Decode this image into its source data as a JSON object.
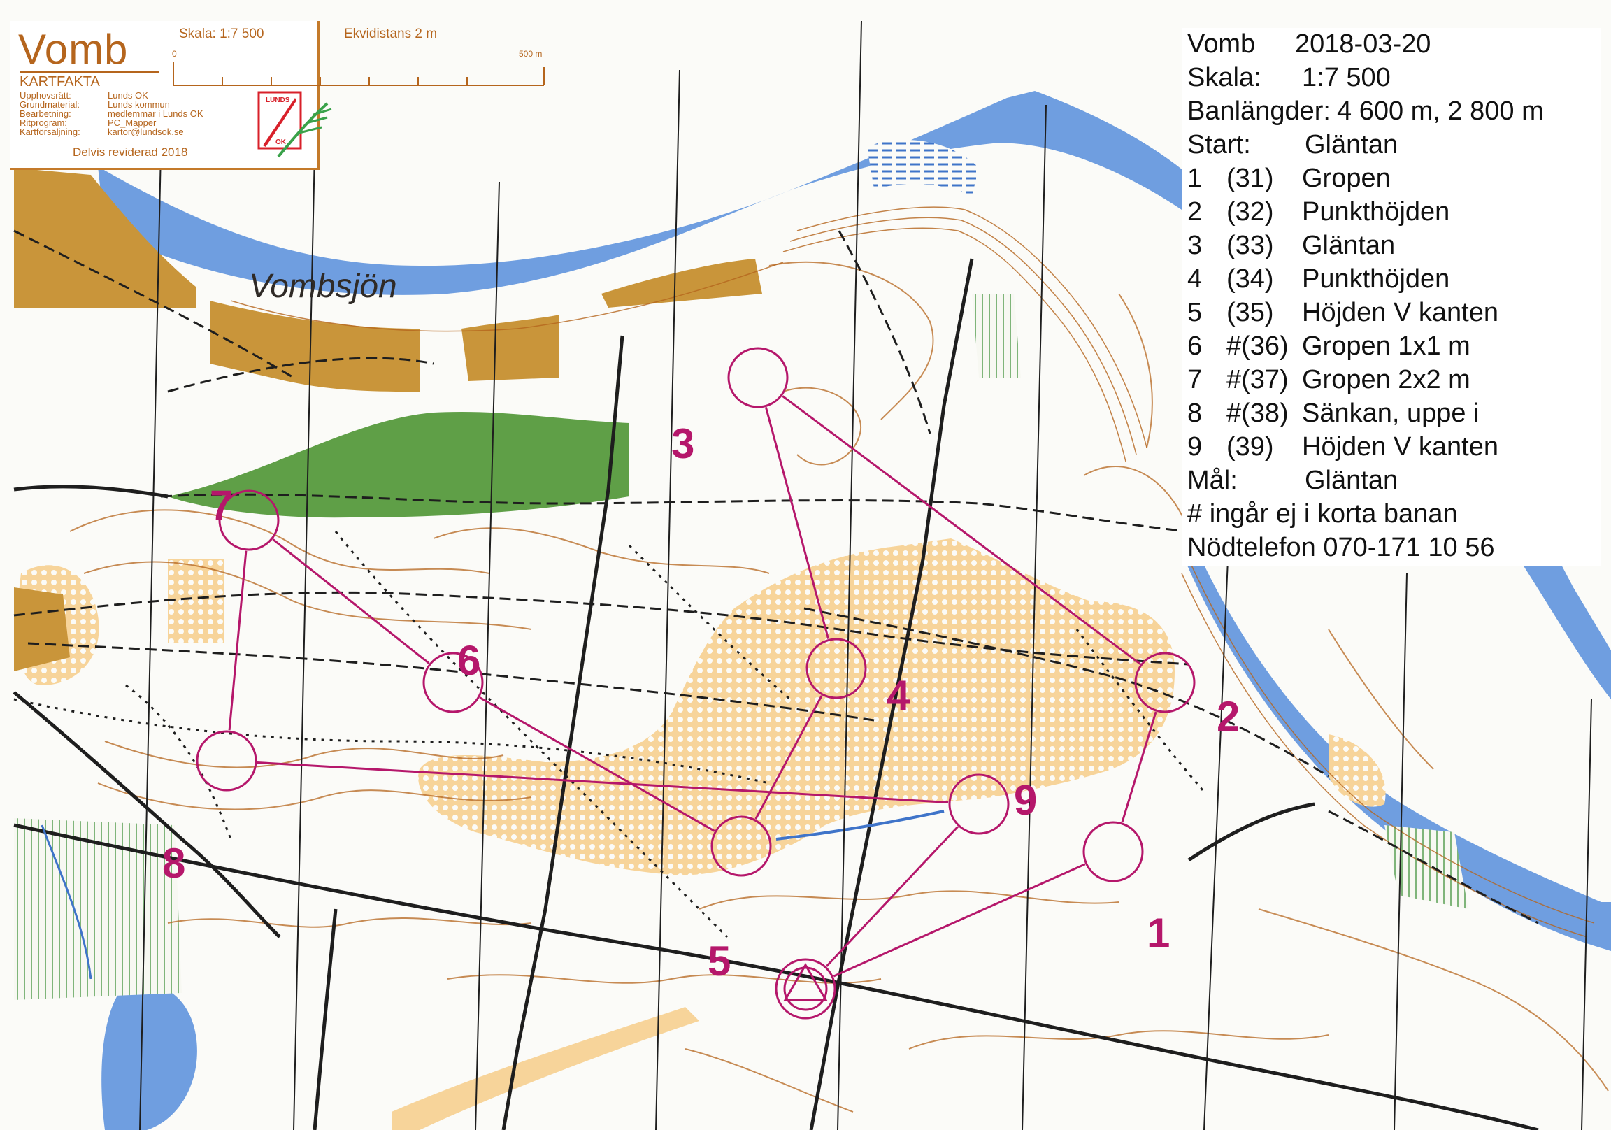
{
  "map_header": {
    "title": "Vomb",
    "kartfakta_heading": "KARTFAKTA",
    "facts": [
      {
        "label": "Upphovsrätt:",
        "value": "Lunds OK"
      },
      {
        "label": "Grundmaterial:",
        "value": "Lunds kommun"
      },
      {
        "label": "Bearbetning:",
        "value": "medlemmar i Lunds OK"
      },
      {
        "label": "Ritprogram:",
        "value": "PC_Mapper"
      },
      {
        "label": "Kartförsäljning:",
        "value": "kartor@lundsok.se"
      }
    ],
    "revision": "Delvis reviderad 2018",
    "scale_label": "Skala: 1:7 500",
    "contour_label": "Ekvidistans 2 m",
    "scale_bar_start": "0",
    "scale_bar_end": "500 m"
  },
  "logo": {
    "top_text": "LUNDS",
    "bottom_text": "OK",
    "colors": {
      "red": "#d8202a",
      "green": "#3aa24a"
    }
  },
  "course_info": {
    "header_name": "Vomb",
    "date": "2018-03-20",
    "scale_label": "Skala:",
    "scale_value": "1:7 500",
    "lengths_label": "Banlängder:",
    "lengths_value": "4 600 m, 2 800 m",
    "start_label": "Start:",
    "start_value": "Gläntan",
    "controls": [
      {
        "num": "1",
        "code": "(31)",
        "desc": "Gropen"
      },
      {
        "num": "2",
        "code": "(32)",
        "desc": "Punkthöjden"
      },
      {
        "num": "3",
        "code": "(33)",
        "desc": "Gläntan"
      },
      {
        "num": "4",
        "code": "(34)",
        "desc": "Punkthöjden"
      },
      {
        "num": "5",
        "code": "(35)",
        "desc": "Höjden V kanten"
      },
      {
        "num": "6",
        "code": "#(36)",
        "desc": "Gropen 1x1 m"
      },
      {
        "num": "7",
        "code": "#(37)",
        "desc": "Gropen 2x2 m"
      },
      {
        "num": "8",
        "code": "#(38)",
        "desc": "Sänkan, uppe i"
      },
      {
        "num": "9",
        "code": "(39)",
        "desc": "Höjden V kanten"
      }
    ],
    "finish_label": "Mål:",
    "finish_value": "Gläntan",
    "note": "# ingår ej i korta banan",
    "emergency": "Nödtelefon 070-171 10 56"
  },
  "lake_name": "Vombsjön",
  "control_labels": [
    "1",
    "2",
    "3",
    "4",
    "5",
    "6",
    "7",
    "8",
    "9"
  ],
  "colors": {
    "water": "#6f9ee0",
    "open_land": "#f2c37a",
    "green": "#5f9f47",
    "brown": "#b5651d",
    "course": "#b5176b",
    "black": "#1e1e1e",
    "paper": "#fbfbf8"
  }
}
